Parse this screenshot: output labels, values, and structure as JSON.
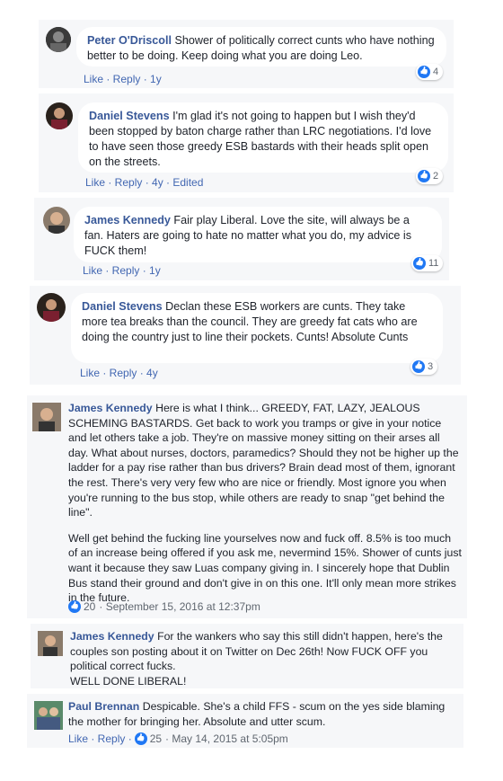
{
  "comments": [
    {
      "name": "Peter O'Driscoll",
      "text": "Shower of politically correct cunts who have nothing better to be doing. Keep doing what you are doing Leo.",
      "actions": "Like · Reply · 1y",
      "likes": "4"
    },
    {
      "name": "Daniel Stevens",
      "text": "I'm glad it's not going to happen but I wish they'd been stopped by baton charge rather than LRC negotiations. I'd love to have seen those greedy ESB bastards with their heads split open on the streets.",
      "actions": "Like · Reply · 4y · Edited",
      "likes": "2"
    },
    {
      "name": "James Kennedy",
      "text": "Fair play Liberal. Love the site, will always be a fan. Haters are going to hate no matter what you do, my advice is FUCK them!",
      "actions": "Like · Reply · 1y",
      "likes": "11"
    },
    {
      "name": "Daniel Stevens",
      "text": "Declan these ESB workers are cunts. They take more tea breaks than the council. They are greedy fat cats who are doing the country just to line their pockets. Cunts! Absolute Cunts",
      "actions": "Like · Reply · 4y",
      "likes": "3"
    }
  ],
  "long_comment": {
    "name": "James Kennedy",
    "para1": "Here is what I think... GREEDY, FAT, LAZY, JEALOUS SCHEMING BASTARDS. Get back to work you tramps or give in your notice and let others take a job. They're on massive money sitting on their arses all day. What about nurses, doctors, paramedics? Should they not be higher up the ladder for a pay rise rather than bus drivers? Brain dead most of them, ignorant the rest. There's very very few who are nice or friendly. Most ignore you when you're running to the bus stop, while others are ready to snap \"get behind the line\".",
    "para2": "Well get behind the fucking line yourselves now and fuck off. 8.5% is too much of an increase being offered if you ask me, nevermind 15%. Shower of cunts just want it because they saw Luas company giving in. I sincerely hope that Dublin Bus stand their ground and don't give in on this one. It'll only mean more strikes in the future.",
    "likes": "20",
    "date": "· September 15, 2016 at 12:37pm"
  },
  "twitter_comment": {
    "name": "James Kennedy",
    "text": "For the wankers who say this still didn't happen, here's the couples son posting about it on Twitter on Dec 26th! Now FUCK OFF you political correct fucks.",
    "line2": "WELL DONE LIBERAL!"
  },
  "last_comment": {
    "name": "Paul Brennan",
    "text": "Despicable. She's a child FFS - scum on the yes side blaming the mother for bringing her. Absolute and utter scum.",
    "actions": "Like · Reply ·",
    "likes": "25",
    "date": "· May 14, 2015 at 5:05pm"
  },
  "colors": {
    "name": "#385898",
    "like_blue": "#2078f4",
    "card_bg": "#f6f7f9",
    "meta": "#606770"
  }
}
